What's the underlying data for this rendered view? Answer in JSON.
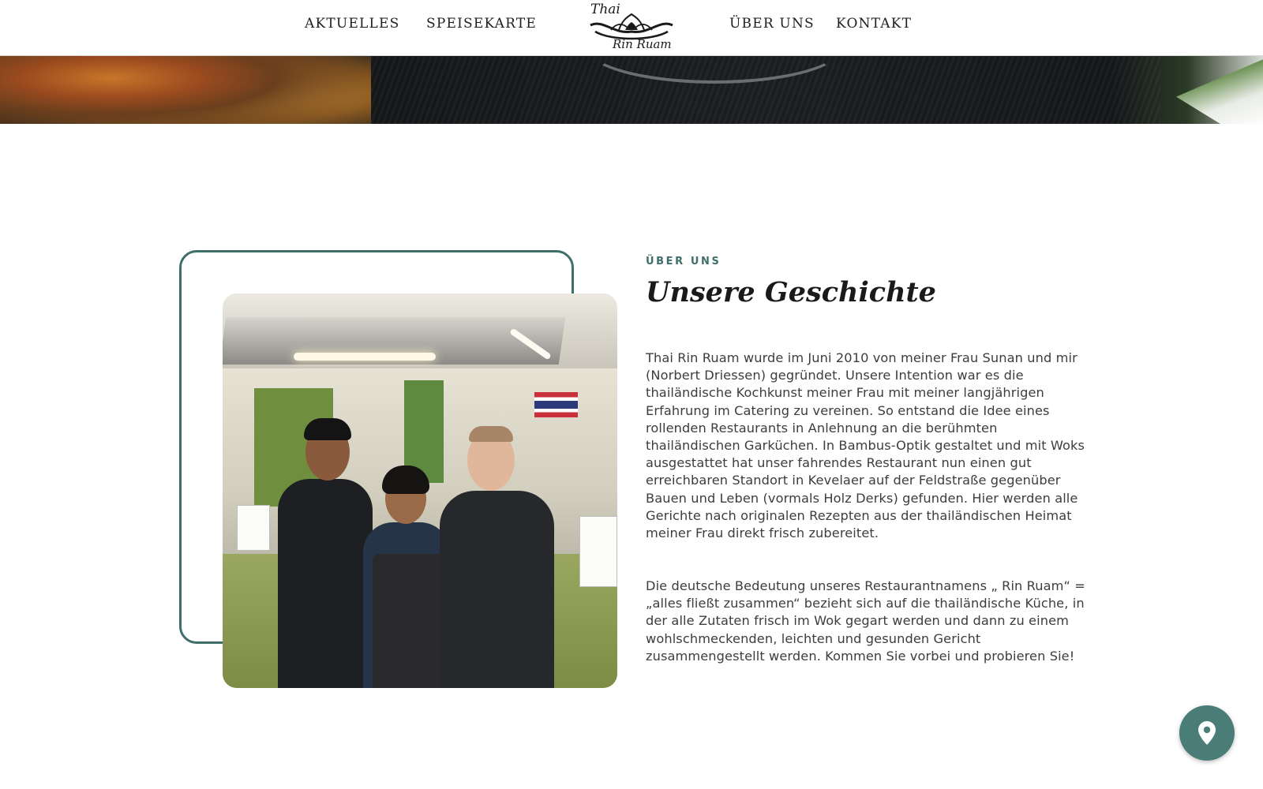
{
  "header": {
    "nav": {
      "aktuelles": "AKTUELLES",
      "speisekarte": "SPEISEKARTE",
      "ueber_uns": "ÜBER UNS",
      "kontakt": "KONTAKT"
    },
    "logo": {
      "line1": "Thai",
      "line2": "Rin Ruam",
      "icon": "lotus-logo-icon"
    }
  },
  "about": {
    "eyebrow": "ÜBER UNS",
    "title": "Unsere Geschichte",
    "paragraph_1": "Thai Rin Ruam wurde im Juni 2010 von meiner Frau Sunan und mir (Norbert Driessen) gegründet. Unsere Intention war es die thailändische Kochkunst meiner Frau mit meiner langjährigen Erfahrung im Catering zu vereinen. So entstand die Idee eines rollenden Restaurants in Anlehnung an die berühmten thailändischen Garküchen. In Bambus-Optik gestaltet und mit Woks ausgestattet hat unser fahrendes Restaurant nun einen gut erreichbaren Standort in Kevelaer auf der Feldstraße gegenüber Bauen und Leben (vormals Holz Derks) gefunden. Hier werden alle Gerichte nach originalen Rezepten aus der thailändischen Heimat meiner Frau direkt frisch zubereitet.",
    "paragraph_2": "Die deutsche Bedeutung unseres Restaurantnamens „ Rin Ruam“ = „alles fließt zusammen“ bezieht sich auf die thailändische Küche, in der alle Zutaten frisch im Wok gegart werden und dann zu einem wohlschmeckenden, leichten und gesunden Gericht zusammengestellt werden. Kommen Sie vorbei und probieren Sie!"
  },
  "floating_button": {
    "icon": "map-pin-icon"
  },
  "colors": {
    "accent": "#3f6f6a",
    "fab": "#4a7c78",
    "text": "#3d3d3d",
    "heading": "#1a1a1a"
  }
}
